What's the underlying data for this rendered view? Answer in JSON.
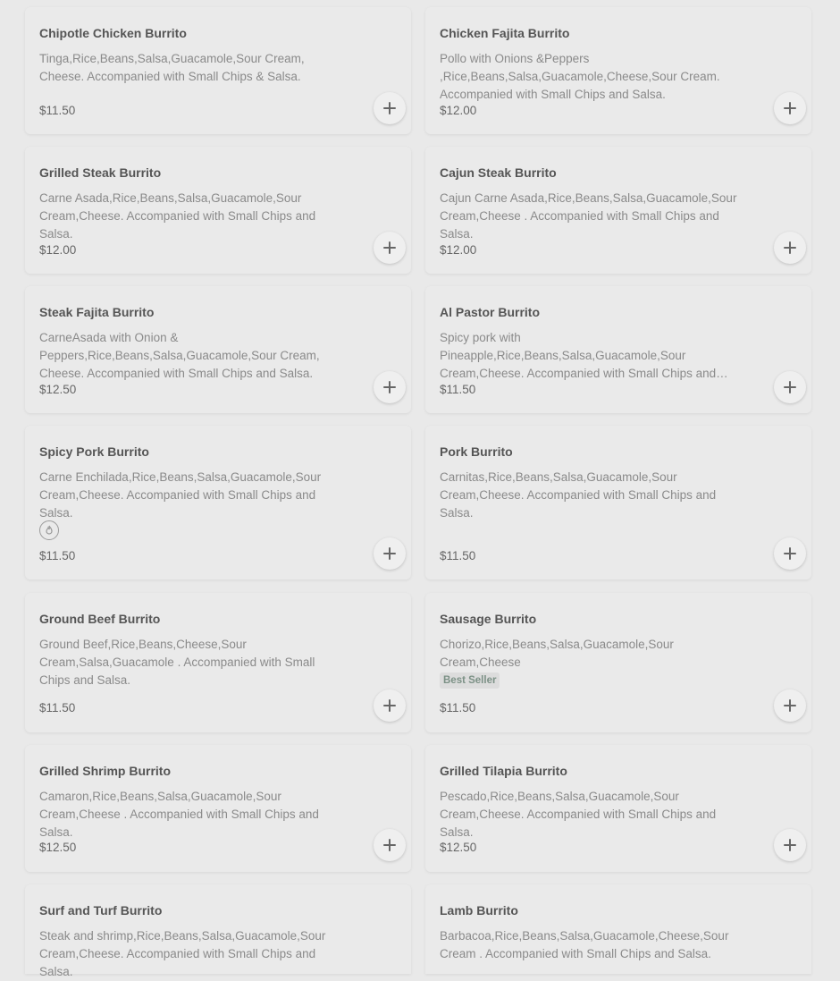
{
  "menu_items": [
    {
      "name": "Chipotle Chicken Burrito",
      "description": "Tinga,Rice,Beans,Salsa,Guacamole,Sour Cream, Cheese. Accompanied with Small Chips & Salsa.",
      "price": "$11.50"
    },
    {
      "name": "Chicken Fajita Burrito",
      "description": "Pollo with Onions &Peppers ,Rice,Beans,Salsa,Guacamole,Cheese,Sour Cream. Accompanied with Small Chips and Salsa.",
      "price": "$12.00"
    },
    {
      "name": "Grilled Steak Burrito",
      "description": "Carne Asada,Rice,Beans,Salsa,Guacamole,Sour Cream,Cheese. Accompanied with Small Chips and Salsa.",
      "price": "$12.00"
    },
    {
      "name": "Cajun Steak Burrito",
      "description": "Cajun Carne Asada,Rice,Beans,Salsa,Guacamole,Sour Cream,Cheese . Accompanied with Small Chips and Salsa.",
      "price": "$12.00"
    },
    {
      "name": "Steak Fajita Burrito",
      "description": "CarneAsada with Onion & Peppers,Rice,Beans,Salsa,Guacamole,Sour Cream, Cheese. Accompanied with Small Chips and Salsa.",
      "price": "$12.50"
    },
    {
      "name": "Al Pastor Burrito",
      "description": "Spicy pork with Pineapple,Rice,Beans,Salsa,Guacamole,Sour Cream,Cheese. Accompanied with Small Chips and Salsa.",
      "price": "$11.50"
    },
    {
      "name": "Spicy Pork Burrito",
      "description": "Carne Enchilada,Rice,Beans,Salsa,Guacamole,Sour Cream,Cheese. Accompanied with Small Chips and Salsa.",
      "price": "$11.50",
      "icon": "spicy-flame-icon"
    },
    {
      "name": "Pork Burrito",
      "description": "Carnitas,Rice,Beans,Salsa,Guacamole,Sour Cream,Cheese. Accompanied with Small Chips and Salsa.",
      "price": "$11.50"
    },
    {
      "name": "Ground Beef Burrito",
      "description": "Ground Beef,Rice,Beans,Cheese,Sour Cream,Salsa,Guacamole . Accompanied with Small Chips and Salsa.",
      "price": "$11.50"
    },
    {
      "name": "Sausage Burrito",
      "description": "Chorizo,Rice,Beans,Salsa,Guacamole,Sour Cream,Cheese",
      "price": "$11.50",
      "badge": "Best Seller"
    },
    {
      "name": "Grilled Shrimp Burrito",
      "description": "Camaron,Rice,Beans,Salsa,Guacamole,Sour Cream,Cheese . Accompanied with Small Chips and Salsa.",
      "price": "$12.50"
    },
    {
      "name": "Grilled Tilapia Burrito",
      "description": "Pescado,Rice,Beans,Salsa,Guacamole,Sour Cream,Cheese. Accompanied with Small Chips and Salsa.",
      "price": "$12.50"
    },
    {
      "name": "Surf and Turf Burrito",
      "description": "Steak and shrimp,Rice,Beans,Salsa,Guacamole,Sour Cream,Cheese. Accompanied with Small Chips and Salsa.",
      "price": ""
    },
    {
      "name": "Lamb Burrito",
      "description": "Barbacoa,Rice,Beans,Salsa,Guacamole,Cheese,Sour Cream . Accompanied with Small Chips and Salsa.",
      "price": ""
    }
  ],
  "add_icon": "plus-icon",
  "colors": {
    "background": "#e9e9e9",
    "card": "#eaeaea",
    "badge_text": "#7c9186"
  }
}
